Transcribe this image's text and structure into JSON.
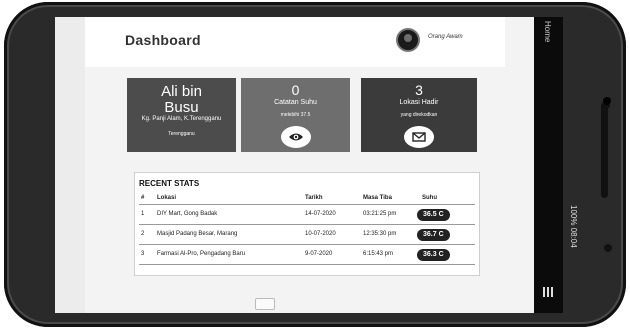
{
  "header": {
    "title": "Dashboard",
    "user_name": "Orang Awam"
  },
  "cards": [
    {
      "name_line1": "Ali bin",
      "name_line2": "Busu",
      "address": "Kg. Panji Alam, K.Terengganu",
      "state": "Terengganu"
    },
    {
      "value": "0",
      "label": "Catatan Suhu",
      "sub": "melebihi 37.5",
      "icon": "eye-icon"
    },
    {
      "value": "3",
      "label": "Lokasi Hadir",
      "sub": "yang direkodkan",
      "icon": "envelope-icon"
    }
  ],
  "stats": {
    "title": "RECENT STATS",
    "headers": {
      "no": "#",
      "location": "Lokasi",
      "date": "Tarikh",
      "time": "Masa Tiba",
      "temp": "Suhu"
    },
    "rows": [
      {
        "no": "1",
        "location": "DIY Mart, Gong Badak",
        "date": "14-07-2020",
        "time": "03:21:25 pm",
        "temp": "36.5 C"
      },
      {
        "no": "2",
        "location": "Masjid Padang Besar, Marang",
        "date": "10-07-2020",
        "time": "12:35:30 pm",
        "temp": "36.7 C"
      },
      {
        "no": "3",
        "location": "Farmasi Al-Pro, Pengadang Baru",
        "date": "9-07-2020",
        "time": "6:15:43 pm",
        "temp": "36.3 C"
      }
    ]
  },
  "device": {
    "nav_home": "Home",
    "status_text": "100% 08:04"
  }
}
